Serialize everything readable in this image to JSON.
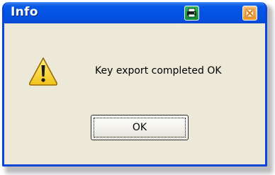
{
  "window": {
    "title": "Info"
  },
  "title_bar": {
    "icons": {
      "print": "printer-icon",
      "close": "close-icon"
    },
    "colors": {
      "title_bar": "#0453e3",
      "print_button": "#1f9a47",
      "close_button": "#eea843"
    }
  },
  "dialog": {
    "icon": "warning-icon",
    "message": "Key export completed OK",
    "ok_label": "OK"
  }
}
